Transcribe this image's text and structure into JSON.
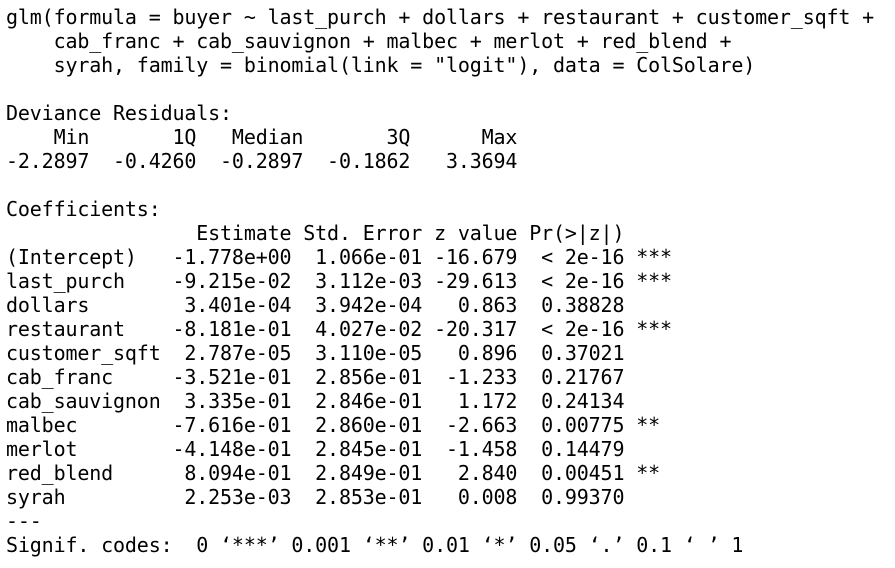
{
  "call": [
    "glm(formula = buyer ~ last_purch + dollars + restaurant + customer_sqft +",
    "    cab_franc + cab_sauvignon + malbec + merlot + red_blend +",
    "    syrah, family = binomial(link = \"logit\"), data = ColSolare)"
  ],
  "deviance": {
    "title": "Deviance Residuals:",
    "header": "    Min       1Q   Median       3Q      Max  ",
    "values": "-2.2897  -0.4260  -0.2897  -0.1862   3.3694  "
  },
  "coefficients": {
    "title": "Coefficients:",
    "header": "                Estimate Std. Error z value Pr(>|z|)    ",
    "rows": [
      "(Intercept)   -1.778e+00  1.066e-01 -16.679  < 2e-16 ***",
      "last_purch    -9.215e-02  3.112e-03 -29.613  < 2e-16 ***",
      "dollars        3.401e-04  3.942e-04   0.863  0.38828    ",
      "restaurant    -8.181e-01  4.027e-02 -20.317  < 2e-16 ***",
      "customer_sqft  2.787e-05  3.110e-05   0.896  0.37021    ",
      "cab_franc     -3.521e-01  2.856e-01  -1.233  0.21767    ",
      "cab_sauvignon  3.335e-01  2.846e-01   1.172  0.24134    ",
      "malbec        -7.616e-01  2.860e-01  -2.663  0.00775 ** ",
      "merlot        -4.148e-01  2.845e-01  -1.458  0.14479    ",
      "red_blend      8.094e-01  2.849e-01   2.840  0.00451 ** ",
      "syrah          2.253e-03  2.853e-01   0.008  0.99370    "
    ]
  },
  "separator": "---",
  "signif": "Signif. codes:  0 ‘***’ 0.001 ‘**’ 0.01 ‘*’ 0.05 ‘.’ 0.1 ‘ ’ 1"
}
